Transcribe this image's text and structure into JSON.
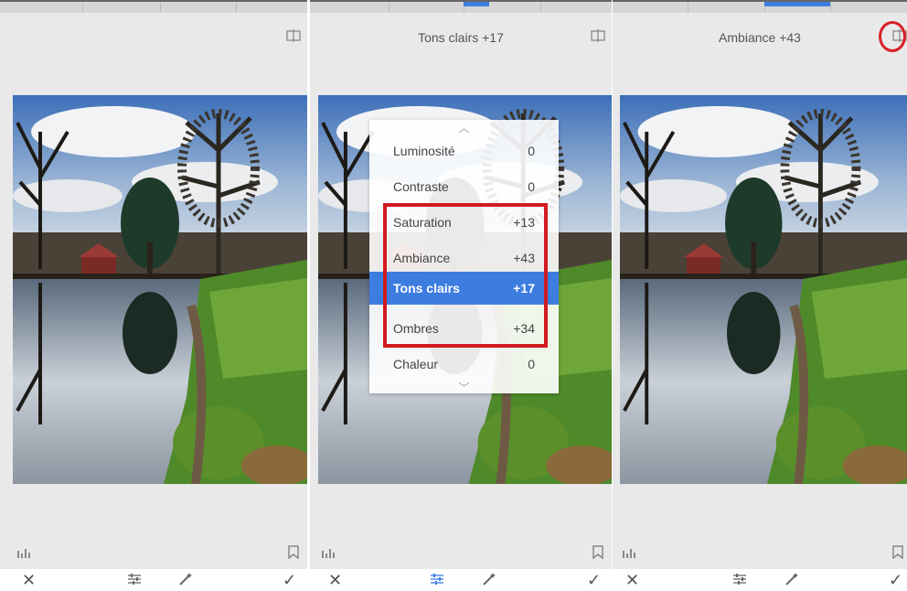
{
  "panels": [
    {
      "title": "",
      "compare_icon": "compare-icon"
    },
    {
      "title": "Tons clairs +17",
      "compare_icon": "compare-icon"
    },
    {
      "title": "Ambiance +43",
      "compare_icon": "compare-icon"
    }
  ],
  "menu": {
    "items": [
      {
        "label": "Luminosité",
        "value": "0"
      },
      {
        "label": "Contraste",
        "value": "0"
      },
      {
        "label": "Saturation",
        "value": "+13"
      },
      {
        "label": "Ambiance",
        "value": "+43"
      },
      {
        "label": "Tons clairs",
        "value": "+17",
        "selected": true
      },
      {
        "label": "Ombres",
        "value": "+34"
      },
      {
        "label": "Chaleur",
        "value": "0"
      }
    ]
  },
  "toolbar": {
    "icons": [
      "close-icon",
      "adjust-sliders-icon",
      "magic-wand-icon",
      "check-icon"
    ],
    "cancel_label": "✕",
    "apply_label": "✓"
  },
  "colors": {
    "accent": "#3d7de0",
    "highlight_red": "#d11a22",
    "panel_bg": "#e9e9e9"
  }
}
